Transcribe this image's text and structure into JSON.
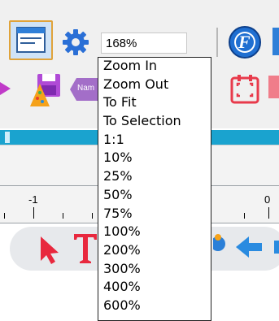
{
  "toolbar": {
    "zoom_value": "168%",
    "f_button_letter": "F",
    "name_chip_text": "Nam"
  },
  "ruler": {
    "labels": [
      "-1",
      "0"
    ]
  },
  "zoom_menu": {
    "items": [
      "Zoom In",
      "Zoom Out",
      "To Fit",
      "To Selection",
      "1:1",
      "10%",
      "25%",
      "50%",
      "75%",
      "100%",
      "200%",
      "300%",
      "400%",
      "600%"
    ]
  },
  "colors": {
    "accent_blue": "#1aa3cf",
    "toolbar_bg": "#f0f0f0",
    "highlight_border": "#e0a33a"
  }
}
